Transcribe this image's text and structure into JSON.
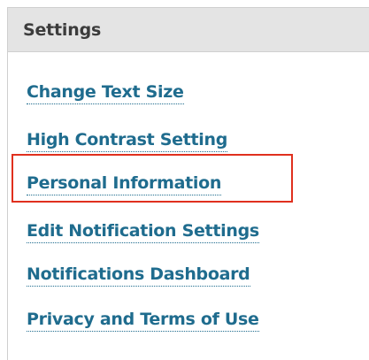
{
  "panel": {
    "title": "Settings"
  },
  "links": [
    {
      "label": "Change Text Size"
    },
    {
      "label": "High Contrast Setting"
    },
    {
      "label": "Personal Information"
    },
    {
      "label": "Edit Notification Settings"
    },
    {
      "label": "Notifications Dashboard"
    },
    {
      "label": "Privacy and Terms of Use"
    }
  ],
  "highlighted_item": "Personal Information",
  "colors": {
    "header_bg": "#e4e4e4",
    "link": "#1f6c8e",
    "highlight_border": "#e0301e",
    "title_text": "#3c3c3c"
  }
}
